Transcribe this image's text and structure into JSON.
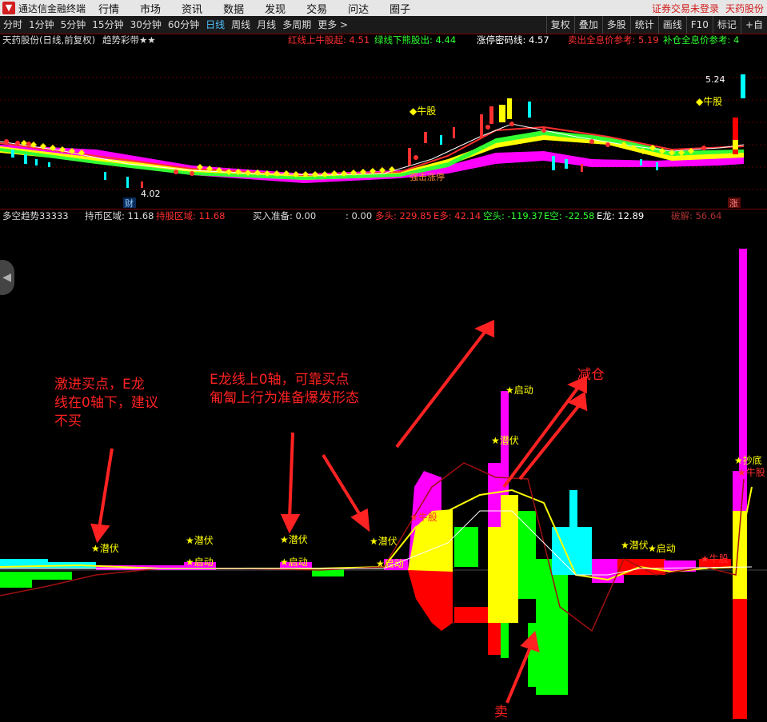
{
  "titlebar": {
    "app_name": "通达信金融终端",
    "menus": [
      "行情",
      "市场",
      "资讯",
      "数据",
      "发现",
      "交易",
      "问达",
      "圈子"
    ],
    "login_status": "证券交易未登录",
    "stock_name": "天药股份"
  },
  "toolbar": {
    "periods": [
      "分时",
      "1分钟",
      "5分钟",
      "15分钟",
      "30分钟",
      "60分钟",
      "日线",
      "周线",
      "月线",
      "多周期",
      "更多 >"
    ],
    "active_period": "日线",
    "right_buttons": [
      "复权",
      "叠加",
      "多股",
      "统计",
      "画线",
      "F10",
      "标记",
      "+自"
    ]
  },
  "upper_info": {
    "stock": "天药股份(日线,前复权)",
    "indicator": "趋势彩带★★",
    "red_line": "红线上牛股起: 4.51",
    "green_line": "绿线下熊股出: 4.44",
    "limit_line": "涨停密码线: 4.57",
    "sell_ref": "卖出全息价参考: 5.19",
    "add_ref": "补仓全息价参考: 4"
  },
  "upper_chart": {
    "labels": {
      "high_price": "5.24",
      "low_price": "4.02",
      "bull": "◆牛股",
      "bull2": "◆牛股",
      "cai": "财",
      "zhang": "涨",
      "limit_text": "强击涨停"
    }
  },
  "lower_info": {
    "indicator": "多空趋势33333",
    "hold_coin": "持币区域: 11.68",
    "hold_stock": "持股区域: 11.68",
    "buy_ready": "买入准备: 0.00",
    "colon_val": ": 0.00",
    "bull_head": "多头: 229.85",
    "e_bull": "E多: 42.14",
    "bear_head": "空头: -119.37",
    "e_bear": "E空: -22.58",
    "e_dragon": "E龙: 12.89",
    "break": "破解: 56.64"
  },
  "lower_chart": {
    "signals": {
      "qianfu": "★潜伏",
      "qidong": "★启动",
      "chaodi": "★抄底",
      "niugu": "★牛股",
      "jianc": "减仓"
    }
  },
  "annotations": {
    "note1": "激进买点，E龙\n线在0轴下，建议\n不买",
    "note2": "E龙线上0轴，可靠买点\n匍匐上行为准备爆发形态",
    "reduce": "减仓",
    "sell": "卖"
  },
  "colors": {
    "background": "#000000",
    "magenta": "#ff00ff",
    "yellow": "#ffff00",
    "red": "#ff0000",
    "green": "#00ff00",
    "cyan": "#00ffff",
    "annotation": "#ff2222"
  }
}
